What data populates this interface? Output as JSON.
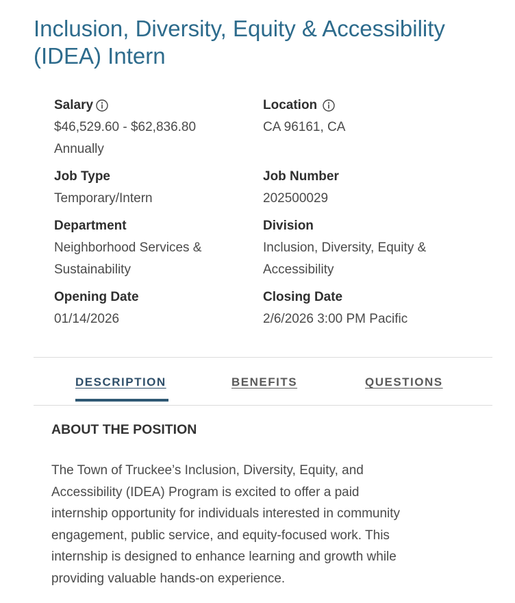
{
  "job": {
    "title": "Inclusion, Diversity, Equity & Accessibility (IDEA) Intern"
  },
  "details": {
    "salary": {
      "label": "Salary",
      "value_line1": "$46,529.60 - $62,836.80",
      "value_line2": "Annually",
      "icon": "info-icon"
    },
    "location": {
      "label": "Location",
      "value": "CA 96161, CA",
      "icon": "info-icon"
    },
    "job_type": {
      "label": "Job Type",
      "value": "Temporary/Intern"
    },
    "job_number": {
      "label": "Job Number",
      "value": "202500029"
    },
    "department": {
      "label": "Department",
      "value_line1": "Neighborhood Services &",
      "value_line2": "Sustainability"
    },
    "division": {
      "label": "Division",
      "value_line1": "Inclusion, Diversity, Equity &",
      "value_line2": "Accessibility"
    },
    "opening_date": {
      "label": "Opening Date",
      "value": "01/14/2026"
    },
    "closing_date": {
      "label": "Closing Date",
      "value": "2/6/2026 3:00 PM Pacific"
    }
  },
  "tabs": [
    {
      "label": "DESCRIPTION",
      "active": true
    },
    {
      "label": "BENEFITS",
      "active": false
    },
    {
      "label": "QUESTIONS",
      "active": false
    }
  ],
  "section": {
    "heading": "ABOUT THE POSITION",
    "lines": [
      "The Town of Truckee’s Inclusion, Diversity, Equity, and",
      "Accessibility (IDEA) Program is excited to offer a paid",
      "internship opportunity for individuals interested in community",
      "engagement, public service, and equity-focused work. This",
      "internship is designed to enhance learning and growth while",
      "providing valuable hands-on experience."
    ]
  },
  "colors": {
    "title": "#2d6b8c",
    "tab_indicator": "#2f5874",
    "divider": "#dcdcdc"
  }
}
